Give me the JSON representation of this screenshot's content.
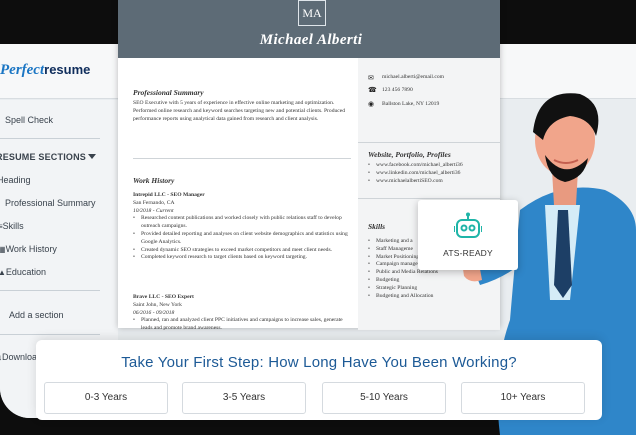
{
  "brand": {
    "logo_part1": "Perfect",
    "logo_part2": "resume",
    "accent": "#1b76c4",
    "navy": "#0f2d5c"
  },
  "sidebar": {
    "spell_check": "Spell Check",
    "section_header": "RESUME SECTIONS",
    "items": [
      {
        "label": "Heading"
      },
      {
        "label": "Professional Summary"
      },
      {
        "label": "Skills"
      },
      {
        "label": "Work History"
      },
      {
        "label": "Education"
      }
    ],
    "add_section": "Add a section",
    "download": "Download"
  },
  "resume": {
    "monogram": "MA",
    "name": "Michael Alberti",
    "header_color": "#5d6b76",
    "summary_title": "Professional Summary",
    "summary_text": "SEO Executive with 5 years of experience in effective online marketing and optimization. Performed online research and keyword searches targeting new and potential clients. Produced performance reports using analytical data gained from research and client analysis.",
    "work_title": "Work History",
    "jobs": [
      {
        "title": "Intrepid LLC - SEO Manager",
        "location": "San Fernando, CA",
        "dates": "10/2018 - Current",
        "bullets": [
          "Researched content publications and worked closely with public relations staff to develop outreach campaigns.",
          "Provided detailed reporting and analyses on client website demographics and statistics using Google Analytics.",
          "Created dynamic SEO strategies to exceed market competitors and meet client needs.",
          "Completed keyword research to target clients based on keyword targeting."
        ]
      },
      {
        "title": "Brave LLC - SEO Expert",
        "location": "Saint John, New York",
        "dates": "06/2016 - 09/2018",
        "bullets": [
          "Planned, ran and analyzed client PPC initiatives and campaigns to increase sales, generate leads and promote brand awareness."
        ]
      }
    ],
    "contact": {
      "email": "michael.alberti@email.com",
      "phone": "123 456 7890",
      "address": "Ballston Lake, NY 12019"
    },
    "web_title": "Website, Portfolio, Profiles",
    "links": [
      "www.facebook.com/michael_alberti36",
      "www.linkedin.com/michael_alberti36",
      "www.michaelalbertiSEO.com"
    ],
    "skills_title": "Skills",
    "skills": [
      "Marketing and a",
      "Staff Manageme",
      "Market Positioning",
      "Campaign management",
      "Public and Media Relations",
      "Budgeting",
      "Strategic Planning",
      "Budgeting and Allocation"
    ]
  },
  "ats": {
    "label": "ATS-READY",
    "icon": "robot-icon",
    "color": "#1fb5a8"
  },
  "prompt": {
    "title": "Take Your First Step: How Long Have You Been Working?",
    "options": [
      "0-3 Years",
      "3-5 Years",
      "5-10 Years",
      "10+ Years"
    ]
  }
}
